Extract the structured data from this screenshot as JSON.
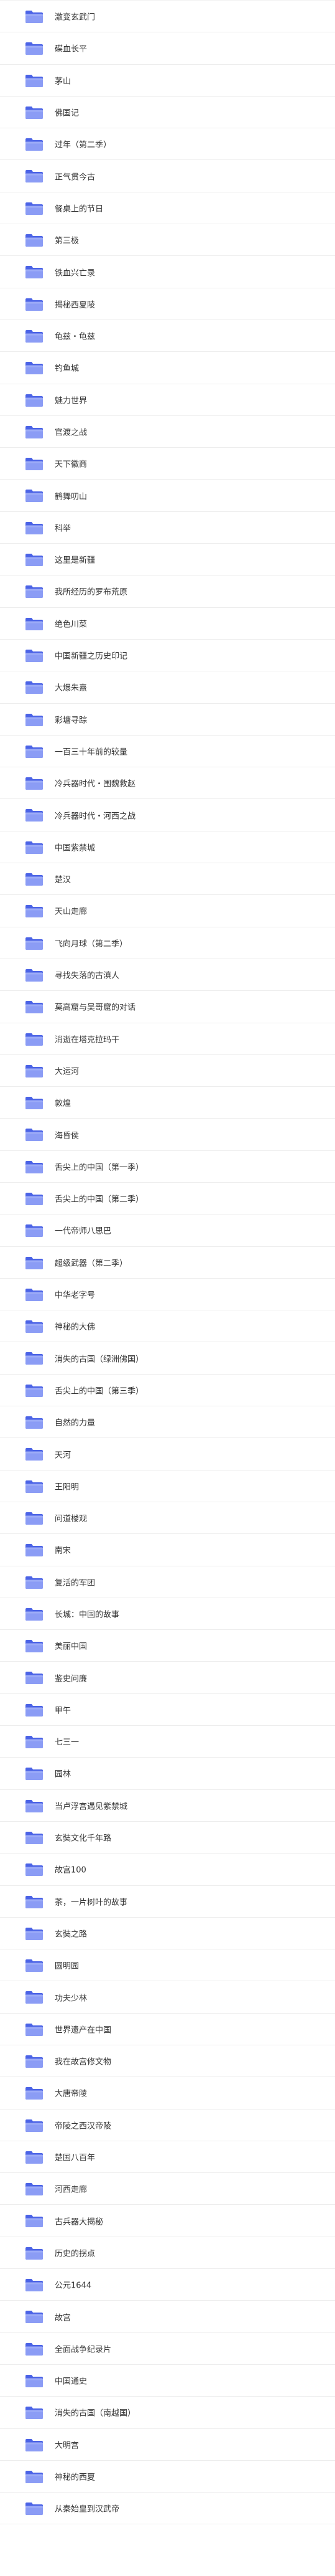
{
  "folder_list": {
    "icon": "folder-icon",
    "colors": {
      "folder_back": "#4b63e6",
      "folder_front": "#8b9cf5",
      "text": "#333333",
      "divider": "#ededed"
    },
    "items": [
      "激变玄武门",
      "碟血长平",
      "茅山",
      "佛国记",
      "过年（第二季）",
      "正气贯今古",
      "餐桌上的节日",
      "第三极",
      "铁血兴亡录",
      "揭秘西夏陵",
      "龟兹・龟兹",
      "钓鱼城",
      "魅力世界",
      "官渡之战",
      "天下徽商",
      "鹤舞叨山",
      "科举",
      "这里是新疆",
      "我所经历的罗布荒原",
      "绝色川菜",
      "中国新疆之历史印记",
      "大爆朱熹",
      "彩塘寻踪",
      "一百三十年前的较量",
      "冷兵器时代・围魏救赵",
      "冷兵器时代・河西之战",
      "中国紫禁城",
      "楚汉",
      "天山走廊",
      "飞向月球（第二季）",
      "寻找失落的古滇人",
      "莫高窟与吴哥窟的对话",
      "消逝在塔克拉玛干",
      "大运河",
      "敦煌",
      "海昏侯",
      "舌尖上的中国（第一季）",
      "舌尖上的中国（第二季）",
      "一代帝师八思巴",
      "超级武器（第二季）",
      "中华老字号",
      "神秘的大佛",
      "消失的古国（绿洲佛国）",
      "舌尖上的中国（第三季）",
      "自然的力量",
      "天河",
      "王阳明",
      "问道楼观",
      "南宋",
      "复活的军团",
      "长城：中国的故事",
      "美丽中国",
      "鉴史问廉",
      "甲午",
      "七三一",
      "园林",
      "当卢浮宫遇见紫禁城",
      "玄奘文化千年路",
      "故宫100",
      "茶，一片树叶的故事",
      "玄奘之路",
      "圆明园",
      "功夫少林",
      "世界遗产在中国",
      "我在故宫修文物",
      "大唐帝陵",
      "帝陵之西汉帝陵",
      "楚国八百年",
      "河西走廊",
      "古兵器大揭秘",
      "历史的拐点",
      "公元1644",
      "故宫",
      "全面战争纪录片",
      "中国通史",
      "消失的古国（南越国）",
      "大明宫",
      "神秘的西夏",
      "从秦始皇到汉武帝"
    ]
  }
}
